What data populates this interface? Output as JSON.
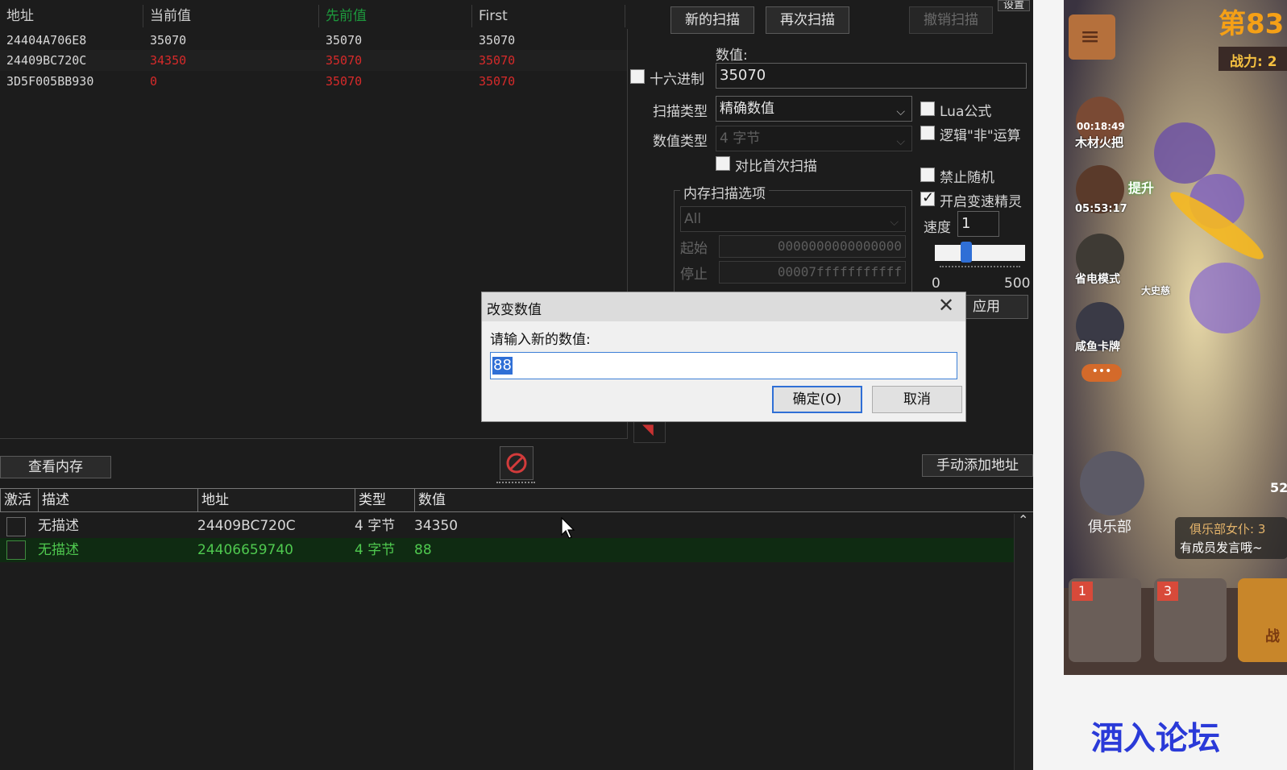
{
  "results": {
    "columns": [
      "地址",
      "当前值",
      "先前值",
      "First"
    ],
    "rows": [
      {
        "address": "24404A706E8",
        "current": "35070",
        "previous": "35070",
        "first": "35070"
      },
      {
        "address": "24409BC720C",
        "current": "34350",
        "previous": "35070",
        "first": "35070"
      },
      {
        "address": "3D5F005BB930",
        "current": "0",
        "previous": "35070",
        "first": "35070"
      }
    ]
  },
  "scan_buttons": {
    "new_scan": "新的扫描",
    "next_scan": "再次扫描",
    "undo_scan": "撤销扫描",
    "settings": "设置"
  },
  "value": {
    "label": "数值:",
    "hex_label": "十六进制",
    "input": "35070"
  },
  "scan_type": {
    "label": "扫描类型",
    "selected": "精确数值"
  },
  "value_type": {
    "label": "数值类型",
    "selected": "4 字节"
  },
  "compare_first": "对比首次扫描",
  "options": {
    "lua": "Lua公式",
    "not": "逻辑\"非\"运算",
    "no_random": "禁止随机",
    "speedhack": "开启变速精灵"
  },
  "speed": {
    "label": "速度",
    "value": "1",
    "min": "0",
    "max": "500"
  },
  "memory": {
    "group": "内存扫描选项",
    "region": "All",
    "start_label": "起始",
    "start_value": "0000000000000000",
    "stop_label": "停止",
    "stop_value": "00007fffffffffff"
  },
  "apply": "应用",
  "view_memory": "查看内存",
  "add_address": "手动添加地址",
  "list": {
    "columns": [
      "激活",
      "描述",
      "地址",
      "类型",
      "数值"
    ],
    "rows": [
      {
        "active": false,
        "desc": "无描述",
        "address": "24409BC720C",
        "type": "4 字节",
        "value": "34350"
      },
      {
        "active": false,
        "desc": "无描述",
        "address": "24406659740",
        "type": "4 字节",
        "value": "88"
      }
    ]
  },
  "dialog": {
    "title": "改变数值",
    "prompt": "请输入新的数值:",
    "input": "88",
    "ok": "确定(O)",
    "cancel": "取消"
  },
  "game": {
    "level": "第83",
    "power": "战力: 2",
    "timer1": "00:18:49",
    "item1": "木材火把",
    "upgrade": "提升",
    "timer2": "05:53:17",
    "power_save": "省电模式",
    "card": "咸鱼卡牌",
    "club": "俱乐部",
    "club_msg1": "俱乐部女仆: 3",
    "club_msg2": "有成员发言哦~",
    "slot1": "1",
    "slot2": "3",
    "battle": "战",
    "side_num": "52",
    "boss": "大史慈",
    "watermark": "酒入论坛"
  }
}
